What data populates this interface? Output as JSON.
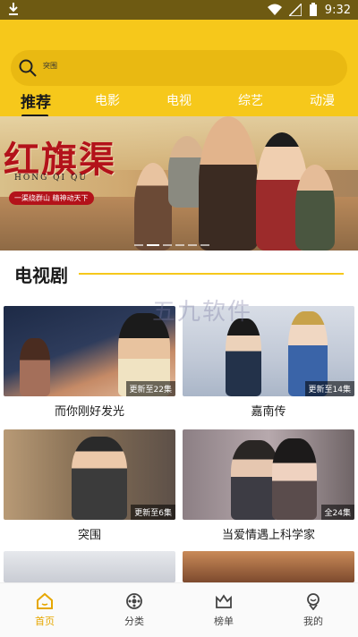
{
  "status_bar": {
    "time": "9:32"
  },
  "search": {
    "text": "突围"
  },
  "tabs": [
    {
      "label": "推荐"
    },
    {
      "label": "电影"
    },
    {
      "label": "电视"
    },
    {
      "label": "综艺"
    },
    {
      "label": "动漫"
    }
  ],
  "banner": {
    "title": "红旗渠",
    "pinyin": "HONG QI QU",
    "slogan": "一渠绕群山 精神动天下"
  },
  "section": {
    "title": "电视剧"
  },
  "watermark": "五九软件",
  "cards": [
    {
      "name": "而你刚好发光",
      "badge": "更新至22集"
    },
    {
      "name": "嘉南传",
      "badge": "更新至14集"
    },
    {
      "name": "突围",
      "badge": "更新至6集"
    },
    {
      "name": "当爱情遇上科学家",
      "badge": "全24集"
    }
  ],
  "bottom_nav": [
    {
      "label": "首页",
      "icon": "home-icon"
    },
    {
      "label": "分类",
      "icon": "category-icon"
    },
    {
      "label": "榜单",
      "icon": "ranking-icon"
    },
    {
      "label": "我的",
      "icon": "profile-icon"
    }
  ],
  "colors": {
    "accent": "#f6c81b",
    "active_nav": "#e6a700",
    "status_bar": "#6e5a12"
  }
}
